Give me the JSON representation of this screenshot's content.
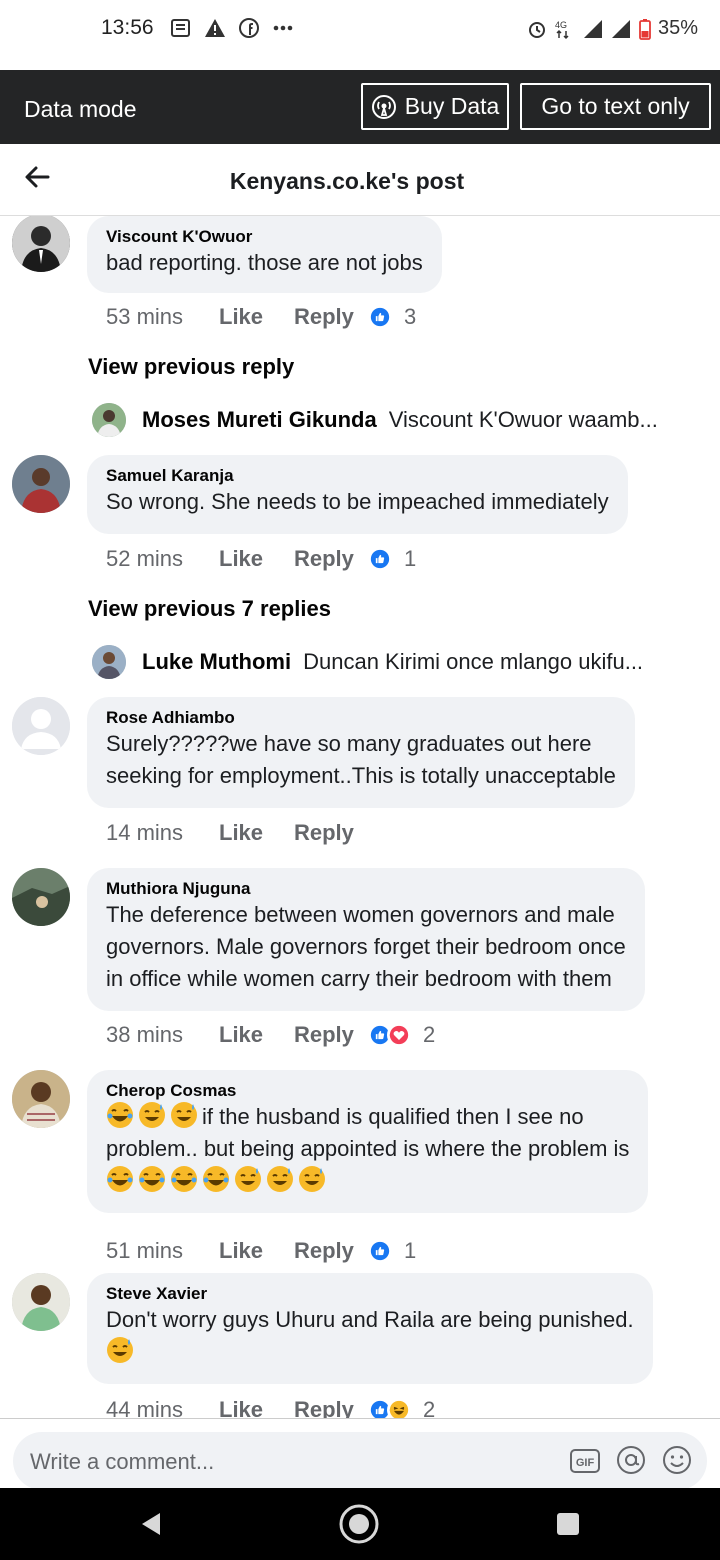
{
  "status_bar": {
    "time": "13:56",
    "battery": "35%",
    "network": "4G"
  },
  "data_bar": {
    "label": "Data mode",
    "buy_data": "Buy Data",
    "text_only": "Go to text only"
  },
  "header": {
    "title": "Kenyans.co.ke's post"
  },
  "comments": [
    {
      "author": "Viscount K'Owuor",
      "lines": [
        "bad reporting. those are not jobs"
      ],
      "time": "53 mins",
      "like": "Like",
      "reply": "Reply",
      "reaction_count": "3"
    },
    {
      "author": "Samuel Karanja",
      "lines": [
        "So wrong. She needs to be impeached immediately"
      ],
      "time": "52 mins",
      "like": "Like",
      "reply": "Reply",
      "reaction_count": "1"
    },
    {
      "author": "Rose Adhiambo",
      "lines": [
        "Surely?????we have so many graduates out here",
        "seeking for employment..This is totally unacceptable"
      ],
      "time": "14 mins",
      "like": "Like",
      "reply": "Reply"
    },
    {
      "author": "Muthiora Njuguna",
      "lines": [
        "The deference between women governors and male",
        "governors. Male governors forget their bedroom once",
        "in office while women carry their bedroom with them"
      ],
      "time": "38 mins",
      "like": "Like",
      "reply": "Reply",
      "reaction_count": "2"
    },
    {
      "author": "Cherop Cosmas",
      "lines": [
        "if the husband is qualified then I see no",
        "problem.. but being appointed is where the problem is"
      ],
      "time": "51 mins",
      "like": "Like",
      "reply": "Reply",
      "reaction_count": "1"
    },
    {
      "author": "Steve Xavier",
      "lines": [
        "Don't worry guys Uhuru and Raila are being punished."
      ],
      "time": "44 mins",
      "like": "Like",
      "reply": "Reply",
      "reaction_count": "2"
    }
  ],
  "view_previous": [
    {
      "label": "View previous reply",
      "name": "Moses Mureti Gikunda",
      "text": "Viscount K'Owuor waamb..."
    },
    {
      "label": "View previous 7 replies",
      "name": "Luke Muthomi",
      "text": "Duncan Kirimi once mlango ukifu..."
    }
  ],
  "composer": {
    "placeholder": "Write a comment..."
  },
  "icons": [
    "back-arrow-icon",
    "like-icon",
    "love-icon",
    "haha-icon",
    "gif-icon",
    "mention-icon",
    "emoji-icon"
  ],
  "colors": {
    "like_blue": "#1877f2",
    "love_red": "#f33e58",
    "haha_yellow": "#f7b928",
    "bar_dark": "#242526"
  }
}
